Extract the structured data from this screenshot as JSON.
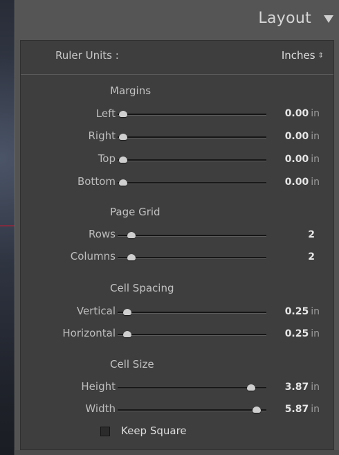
{
  "panel": {
    "title": "Layout",
    "collapse_icon": "triangle-down-icon"
  },
  "ruler": {
    "label": "Ruler Units :",
    "value": "Inches",
    "stepper_icon": "up-down-stepper-icon"
  },
  "margins": {
    "title": "Margins",
    "rows": [
      {
        "label": "Left",
        "value": "0.00",
        "unit": "in",
        "fraction": 0.0
      },
      {
        "label": "Right",
        "value": "0.00",
        "unit": "in",
        "fraction": 0.0
      },
      {
        "label": "Top",
        "value": "0.00",
        "unit": "in",
        "fraction": 0.0
      },
      {
        "label": "Bottom",
        "value": "0.00",
        "unit": "in",
        "fraction": 0.0
      }
    ]
  },
  "page_grid": {
    "title": "Page Grid",
    "rows": [
      {
        "label": "Rows",
        "value": "2",
        "unit": "",
        "fraction": 0.06
      },
      {
        "label": "Columns",
        "value": "2",
        "unit": "",
        "fraction": 0.06
      }
    ]
  },
  "cell_spacing": {
    "title": "Cell Spacing",
    "rows": [
      {
        "label": "Vertical",
        "value": "0.25",
        "unit": "in",
        "fraction": 0.03
      },
      {
        "label": "Horizontal",
        "value": "0.25",
        "unit": "in",
        "fraction": 0.03
      }
    ]
  },
  "cell_size": {
    "title": "Cell Size",
    "rows": [
      {
        "label": "Height",
        "value": "3.87",
        "unit": "in",
        "fraction": 0.93
      },
      {
        "label": "Width",
        "value": "5.87",
        "unit": "in",
        "fraction": 0.97
      }
    ]
  },
  "keep_square": {
    "label": "Keep Square",
    "checked": false
  },
  "colors": {
    "panel_bg": "#535353",
    "content_bg": "#3e3e3e",
    "text": "#bdbdbd",
    "value_text": "#e6e6e6",
    "thumb": "#cfcfcf"
  }
}
